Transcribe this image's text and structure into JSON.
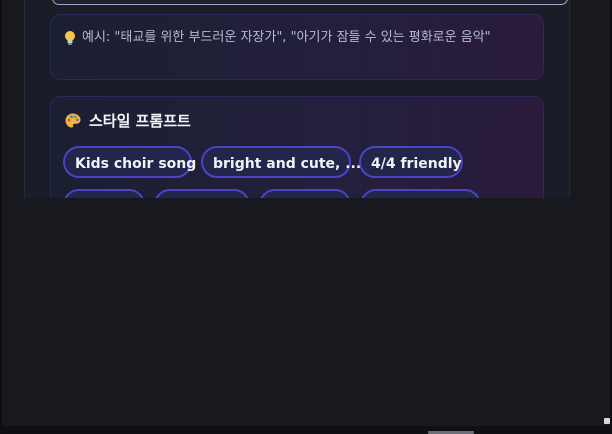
{
  "hint": {
    "icon": "lightbulb-icon",
    "text": "예시: \"태교를 위한 부드러운 자장가\", \"아기가 잠들 수 있는 평화로운 음악\""
  },
  "style_prompt": {
    "icon": "palette-icon",
    "title": "스타일 프롬프트",
    "chips": [
      {
        "label": "Kids choir song"
      },
      {
        "label": "bright and cute, ..."
      },
      {
        "label": "4/4 friendly"
      },
      {
        "label": ""
      },
      {
        "label": ""
      },
      {
        "label": ""
      },
      {
        "label": ""
      }
    ]
  },
  "colors": {
    "accent_border": "#4a44c4",
    "chip_background": "#22264a",
    "panel_background": "#1a1d27"
  }
}
